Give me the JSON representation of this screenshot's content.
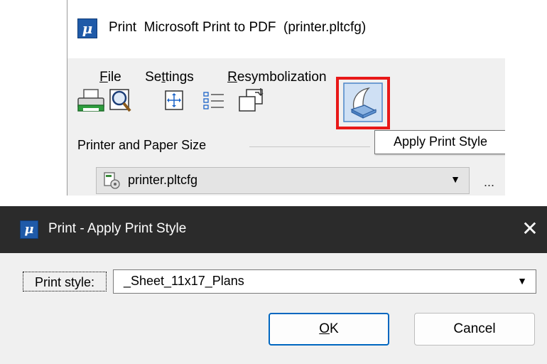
{
  "print_window": {
    "title": "Print  Microsoft Print to PDF  (printer.pltcfg)",
    "menu": [
      {
        "pre": "",
        "ul": "F",
        "post": "ile"
      },
      {
        "pre": "Se",
        "ul": "t",
        "post": "tings"
      },
      {
        "pre": "",
        "ul": "R",
        "post": "esymbolization"
      }
    ],
    "toolbar_icons": [
      "printer-icon",
      "preview-magnifier-icon",
      "fit-view-icon",
      "list-settings-icon",
      "maximize-print-area-icon",
      "apply-print-style-icon"
    ],
    "tooltip": "Apply Print Style",
    "section_label": "Printer and Paper Size",
    "printer_combo_value": "printer.pltcfg",
    "ellipsis": "...",
    "highlight_color": "#e81818"
  },
  "dialog": {
    "title": "Print - Apply Print Style",
    "close_glyph": "✕",
    "field_label": "Print style:",
    "field_value": "_Sheet_11x17_Plans",
    "ok": {
      "ul": "O",
      "post": "K"
    },
    "cancel": "Cancel",
    "accent_color": "#0067c0"
  }
}
